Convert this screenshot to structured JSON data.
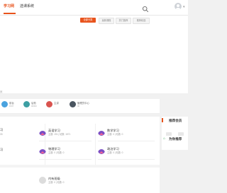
{
  "topbar": {
    "nav": [
      {
        "label": "学习网"
      },
      {
        "label": "选课系统"
      }
    ]
  },
  "filters": {
    "buttons": [
      {
        "label": "全部分类"
      },
      {
        "label": "最新课程"
      },
      {
        "label": "热门推荐"
      },
      {
        "label": "推荐精选"
      }
    ]
  },
  "hero": {
    "crumb": "页"
  },
  "stats": [
    {
      "label": "前台",
      "sub": "1537",
      "color": "#4aa3df"
    },
    {
      "label": "后勤",
      "sub": "00000",
      "color": "#3d9fa3"
    },
    {
      "label": "主讲",
      "sub": "",
      "color": "#d9534f"
    },
    {
      "label": "管理员中心",
      "sub": "00",
      "color": "#4a5560"
    }
  ],
  "courses": [
    {
      "title": "英语学习",
      "sub": "主题: 191 | 帖数: 1571"
    },
    {
      "title": "数学学习",
      "sub": "主题: 0 | 帖数: 0"
    },
    {
      "title": "物理学习",
      "sub": "主题: 0 | 帖数: 0"
    },
    {
      "title": "政治学习",
      "sub": "主题: 0 | 帖数: 0"
    },
    {
      "title": "内有班级",
      "sub": "主题: 0 | 帖数: 0"
    }
  ],
  "left_edge": {
    "row1_title": "习",
    "row1_sub": "33",
    "row2_title": "习"
  },
  "sidebar": {
    "members_title": "推荐会员",
    "members": [
      {
        "name": "tutu"
      },
      {
        "name": "我喜欢己"
      }
    ],
    "hot_title": "为你推荐"
  },
  "colors": {
    "accent": "#e8531c",
    "green": "#3aa755"
  }
}
